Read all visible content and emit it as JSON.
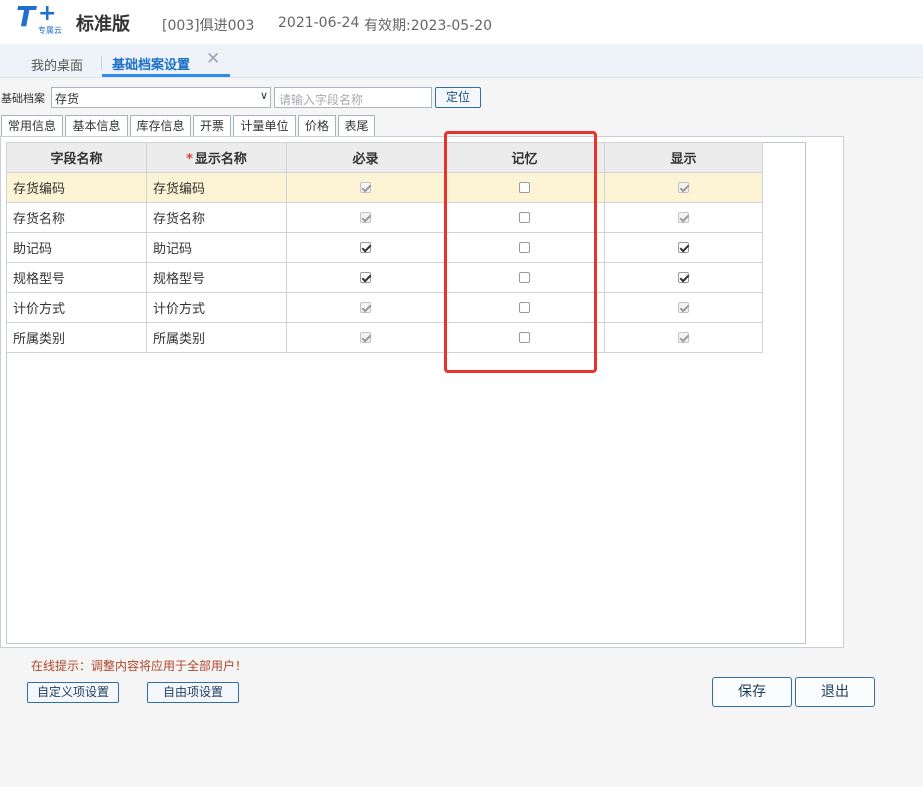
{
  "header": {
    "edition": "标准版",
    "logo_sub": "专属云",
    "account": "[003]俱进003",
    "date": "2021-06-24",
    "validity": "有效期:2023-05-20"
  },
  "tabs": {
    "home": "我的桌面",
    "active": "基础档案设置",
    "close": "✕"
  },
  "filter": {
    "label": "基础档案",
    "selected": "存货",
    "search_placeholder": "请输入字段名称",
    "locate_label": "定位"
  },
  "subtabs": [
    "常用信息",
    "基本信息",
    "库存信息",
    "开票",
    "计量单位",
    "价格",
    "表尾"
  ],
  "table": {
    "columns": [
      "字段名称",
      "显示名称",
      "必录",
      "记忆",
      "显示"
    ],
    "required_marker": "*",
    "rows": [
      {
        "field": "存货编码",
        "display": "存货编码",
        "required": true,
        "required_disabled": true,
        "memory": false,
        "show": true,
        "show_disabled": true
      },
      {
        "field": "存货名称",
        "display": "存货名称",
        "required": true,
        "required_disabled": true,
        "memory": false,
        "show": true,
        "show_disabled": true
      },
      {
        "field": "助记码",
        "display": "助记码",
        "required": true,
        "required_disabled": false,
        "memory": false,
        "show": true,
        "show_disabled": false
      },
      {
        "field": "规格型号",
        "display": "规格型号",
        "required": true,
        "required_disabled": false,
        "memory": false,
        "show": true,
        "show_disabled": false
      },
      {
        "field": "计价方式",
        "display": "计价方式",
        "required": true,
        "required_disabled": true,
        "memory": false,
        "show": true,
        "show_disabled": true
      },
      {
        "field": "所属类别",
        "display": "所属类别",
        "required": true,
        "required_disabled": true,
        "memory": false,
        "show": true,
        "show_disabled": true
      }
    ]
  },
  "footer": {
    "hint": "在线提示：调整内容将应用于全部用户！",
    "custom_btn": "自定义项设置",
    "free_btn": "自由项设置",
    "save": "保存",
    "exit": "退出"
  },
  "colors": {
    "accent": "#2d8cf0",
    "highlight": "#e8322b",
    "selected_row": "#fdf4d6",
    "logo": "#1f6fd1"
  }
}
